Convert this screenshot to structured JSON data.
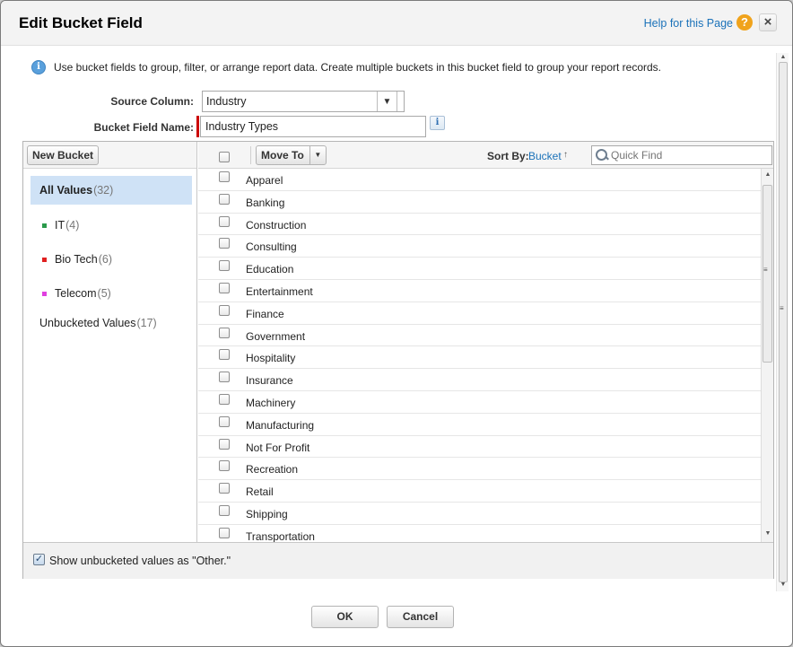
{
  "dialog": {
    "title": "Edit Bucket Field",
    "help_link": "Help for this Page",
    "help_icon": "?",
    "close_icon": "×"
  },
  "info": {
    "icon": "i",
    "text": "Use bucket fields to group, filter, or arrange report data. Create multiple buckets in this bucket field to group your report records."
  },
  "form": {
    "source_column_label": "Source Column:",
    "source_column_value": "Industry",
    "bucket_field_name_label": "Bucket Field Name:",
    "bucket_field_name_value": "Industry Types",
    "info_icon": "i"
  },
  "left_pane": {
    "new_bucket_label": "New Bucket",
    "buckets": [
      {
        "label": "All Values",
        "count": "(32)",
        "selected": true
      },
      {
        "label": "IT",
        "count": "(4)",
        "color": "#2a9a4b"
      },
      {
        "label": "Bio Tech",
        "count": "(6)",
        "color": "#e02020"
      },
      {
        "label": "Telecom",
        "count": "(5)",
        "color": "#e040e0"
      },
      {
        "label": "Unbucketed Values",
        "count": "(17)"
      }
    ]
  },
  "right_pane": {
    "move_to_label": "Move To",
    "sort_by_label": "Sort By:",
    "sort_by_value": "Bucket",
    "sort_direction": "↑",
    "quick_find_placeholder": "Quick Find",
    "values": [
      "Apparel",
      "Banking",
      "Construction",
      "Consulting",
      "Education",
      "Entertainment",
      "Finance",
      "Government",
      "Hospitality",
      "Insurance",
      "Machinery",
      "Manufacturing",
      "Not For Profit",
      "Recreation",
      "Retail",
      "Shipping",
      "Transportation"
    ]
  },
  "options": {
    "show_unbucketed_label": "Show unbucketed values as \"Other.\"",
    "show_unbucketed_checked": true
  },
  "footer": {
    "ok_label": "OK",
    "cancel_label": "Cancel"
  }
}
